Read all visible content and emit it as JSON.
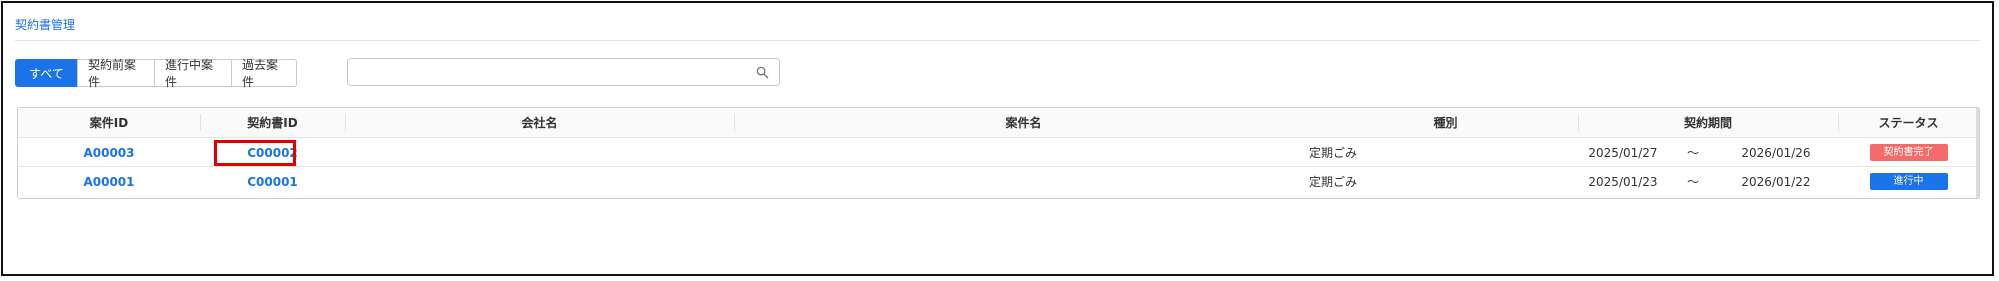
{
  "page": {
    "title": "契約書管理"
  },
  "filter_tabs": [
    {
      "label": "すべて",
      "active": true
    },
    {
      "label": "契約前案件",
      "active": false
    },
    {
      "label": "進行中案件",
      "active": false
    },
    {
      "label": "過去案件",
      "active": false
    }
  ],
  "search": {
    "value": "",
    "placeholder": "",
    "icon": "search-icon"
  },
  "table": {
    "columns": [
      "案件ID",
      "契約書ID",
      "会社名",
      "案件名",
      "種別",
      "契約期間",
      "ステータス"
    ],
    "rows": [
      {
        "project_id": "A00003",
        "contract_id": "C00002",
        "company": "",
        "project_name": "",
        "type": "定期ごみ",
        "period_start": "2025/01/27",
        "period_sep": "〜",
        "period_end": "2026/01/26",
        "status": "契約書完了",
        "status_color": "#f36b6b"
      },
      {
        "project_id": "A00001",
        "contract_id": "C00001",
        "company": "",
        "project_name": "",
        "type": "定期ごみ",
        "period_start": "2025/01/23",
        "period_sep": "〜",
        "period_end": "2026/01/22",
        "status": "進行中",
        "status_color": "#1a73e8"
      }
    ]
  },
  "colors": {
    "accent": "#1a73e8",
    "highlight": "#e00000"
  }
}
